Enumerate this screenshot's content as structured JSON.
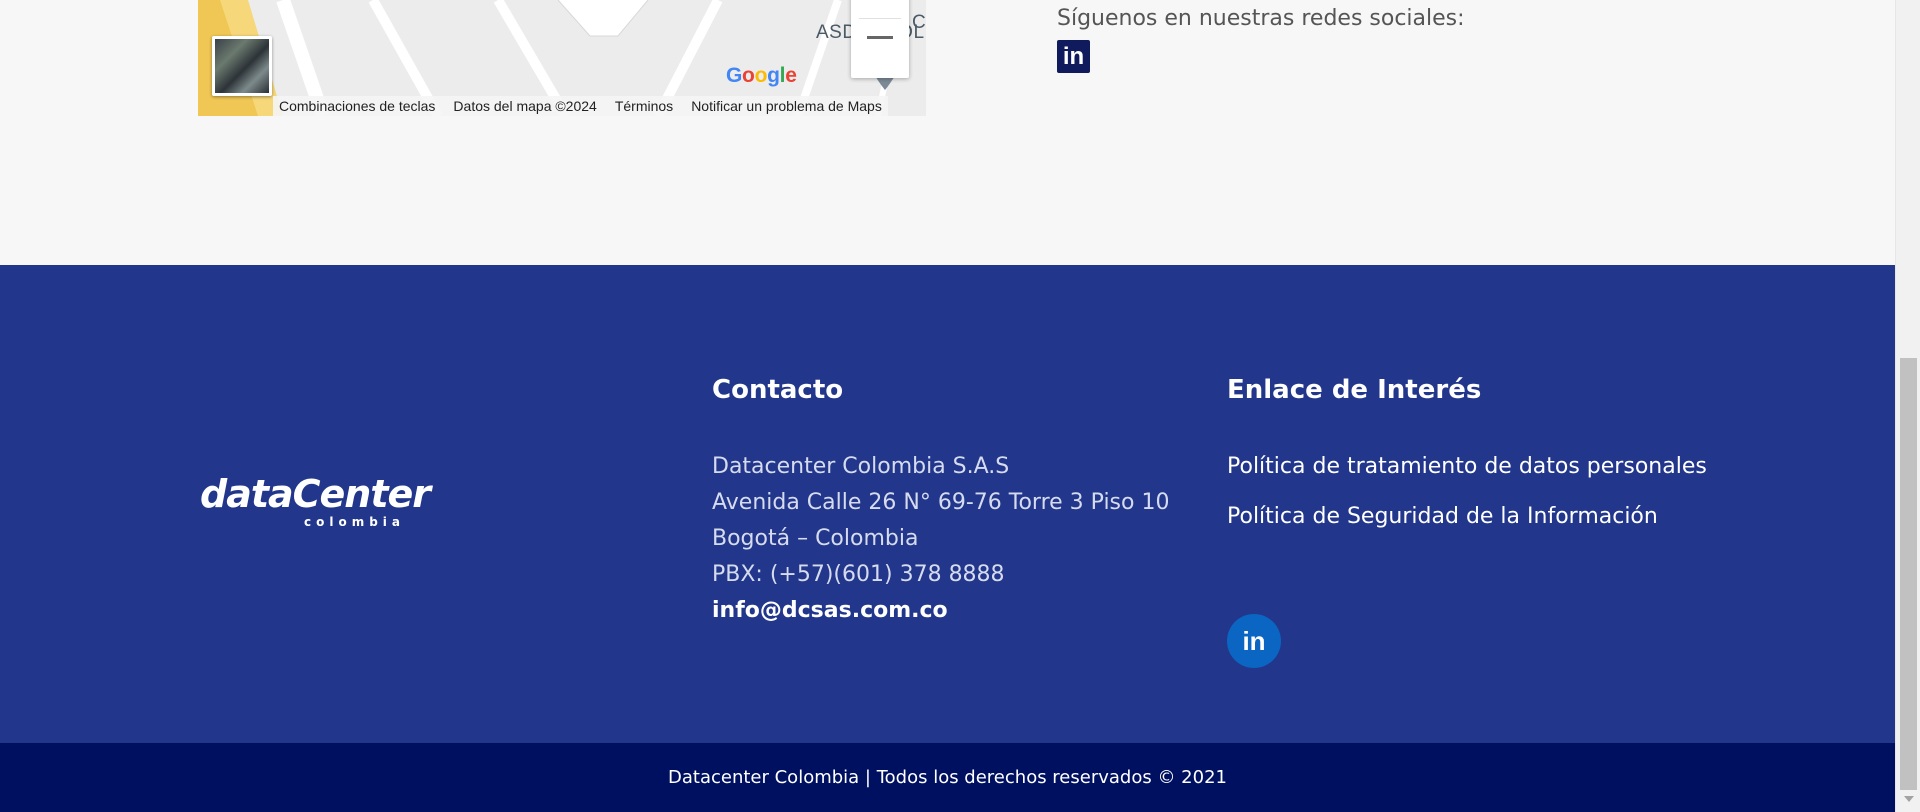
{
  "map": {
    "label": "ASDECCOL",
    "label_partial": "C",
    "google_logo": {
      "G": "G",
      "o1": "o",
      "o2": "o",
      "g": "g",
      "l": "l",
      "e": "e"
    },
    "footer": {
      "shortcuts": "Combinaciones de teclas",
      "map_data": "Datos del mapa ©2024",
      "terms": "Términos",
      "report": "Notificar un problema de Maps"
    }
  },
  "social": {
    "title": "Síguenos en nuestras redes sociales:",
    "linkedin_glyph": "in"
  },
  "footer": {
    "logo": {
      "main": "dataCenter",
      "sub": "colombia"
    },
    "contact": {
      "heading": "Contacto",
      "company": "Datacenter Colombia S.A.S",
      "address": "Avenida Calle 26 N° 69-76 Torre 3 Piso 10",
      "city": "Bogotá – Colombia",
      "phone": "PBX: (+57)(601) 378 8888",
      "email": "info@dcsas.com.co"
    },
    "links": {
      "heading": "Enlace de Interés",
      "items": [
        {
          "label": "Política de tratamiento de datos personales"
        },
        {
          "label": "Política de Seguridad de la Información"
        }
      ],
      "linkedin_glyph": "in"
    },
    "copyright": "Datacenter Colombia | Todos los derechos reservados © 2021"
  },
  "colors": {
    "footer_bg": "#22378b",
    "bottom_bar_bg": "#001060",
    "linkedin_blue": "#0a66c2",
    "page_bg": "#f7f7f7"
  }
}
